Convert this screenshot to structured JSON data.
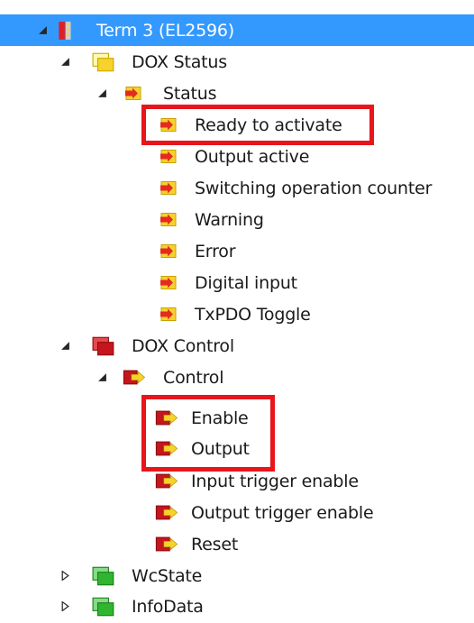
{
  "tree": {
    "term": {
      "label": "Term 3 (EL2596)",
      "icon": "terminal-device-icon",
      "expanded": true,
      "selected": true
    },
    "dox_status": {
      "label": "DOX Status",
      "icon": "input-group-icon",
      "expanded": true
    },
    "status": {
      "label": "Status",
      "icon": "input-variable-icon",
      "expanded": true
    },
    "status_items": [
      {
        "label": "Ready to activate",
        "highlighted": true
      },
      {
        "label": "Output active"
      },
      {
        "label": "Switching operation counter"
      },
      {
        "label": "Warning"
      },
      {
        "label": "Error"
      },
      {
        "label": "Digital input"
      },
      {
        "label": "TxPDO Toggle"
      }
    ],
    "dox_control": {
      "label": "DOX Control",
      "icon": "output-group-icon",
      "expanded": true
    },
    "control": {
      "label": "Control",
      "icon": "output-variable-icon",
      "expanded": true
    },
    "control_items": [
      {
        "label": "Enable",
        "highlighted": true
      },
      {
        "label": "Output",
        "highlighted": true
      },
      {
        "label": "Input trigger enable"
      },
      {
        "label": "Output trigger enable"
      },
      {
        "label": "Reset"
      }
    ],
    "wcstate": {
      "label": "WcState",
      "icon": "status-group-icon",
      "expanded": false
    },
    "infodata": {
      "label": "InfoData",
      "icon": "status-group-icon",
      "expanded": false
    }
  },
  "colors": {
    "selection": "#3399ff",
    "highlight_box": "#e8151b",
    "input_icon": "#f6d22c",
    "output_icon": "#c4161c",
    "status_icon": "#2fb52f"
  }
}
